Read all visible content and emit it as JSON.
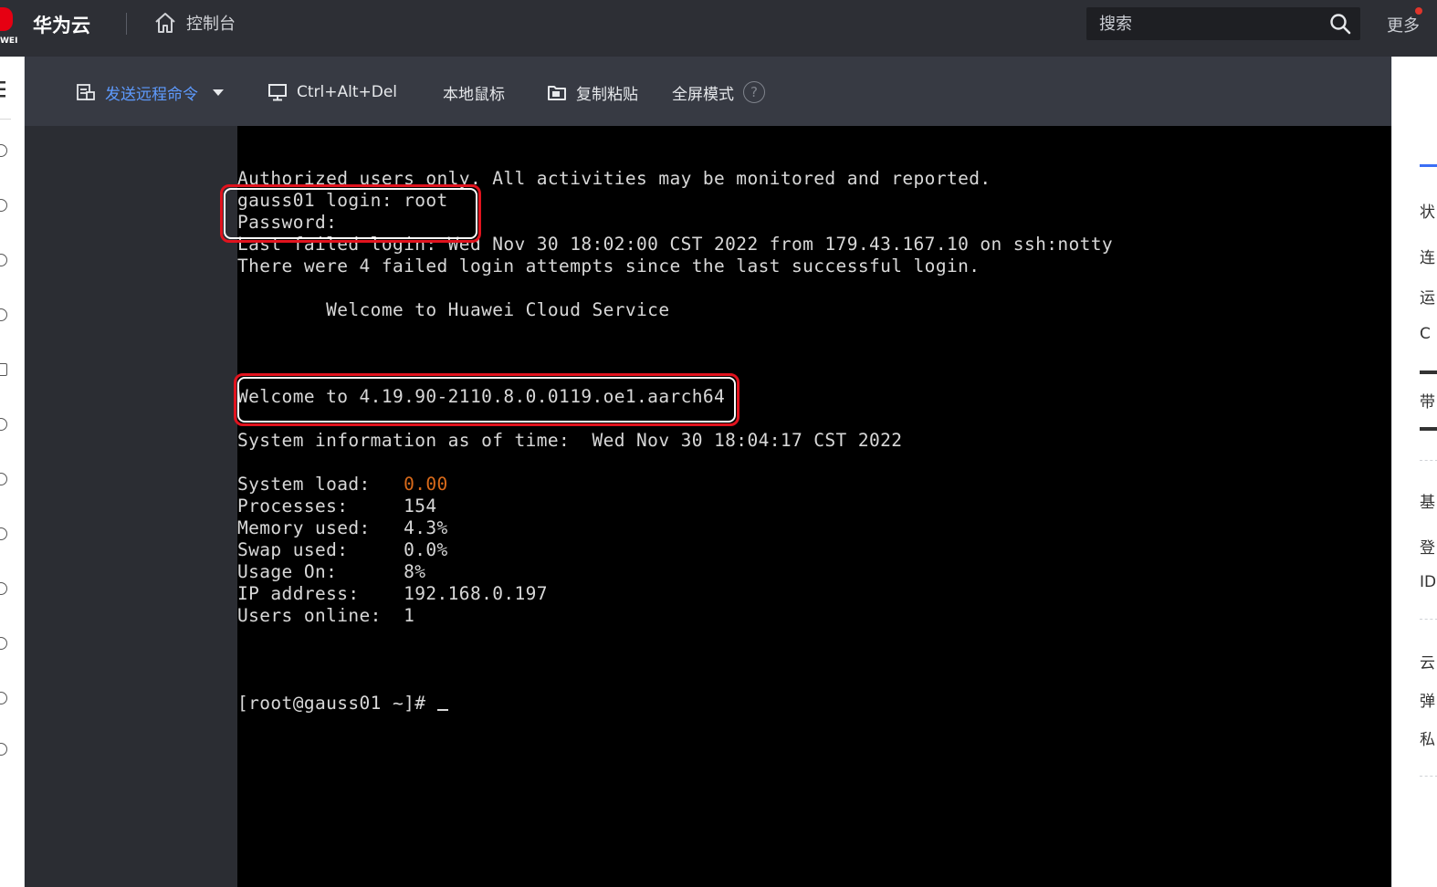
{
  "header": {
    "logo_text": "WEI",
    "brand": "华为云",
    "console_label": "控制台",
    "search_placeholder": "搜索",
    "more_label": "更多"
  },
  "toolbar": {
    "send_command_label": "发送远程命令",
    "ctrl_alt_del_label": "Ctrl+Alt+Del",
    "local_mouse_label": "本地鼠标",
    "copy_paste_label": "复制粘贴",
    "fullscreen_label": "全屏模式",
    "help_glyph": "?"
  },
  "terminal": {
    "lines": [
      "Authorized users only. All activities may be monitored and reported.",
      "gauss01 login: root",
      "Password:",
      "Last failed login: Wed Nov 30 18:02:00 CST 2022 from 179.43.167.10 on ssh:notty",
      "There were 4 failed login attempts since the last successful login.",
      "        Welcome to Huawei Cloud Service",
      "Welcome to 4.19.90-2110.8.0.0119.oe1.aarch64",
      "System information as of time:  Wed Nov 30 18:04:17 CST 2022"
    ],
    "sysinfo": [
      {
        "label": "System load:   ",
        "value": "0.00",
        "highlight": true
      },
      {
        "label": "Processes:     ",
        "value": "154",
        "highlight": false
      },
      {
        "label": "Memory used:   ",
        "value": "4.3%",
        "highlight": false
      },
      {
        "label": "Swap used:     ",
        "value": "0.0%",
        "highlight": false
      },
      {
        "label": "Usage On:      ",
        "value": "8%",
        "highlight": false
      },
      {
        "label": "IP address:    ",
        "value": "192.168.0.197",
        "highlight": false
      },
      {
        "label": "Users online:  ",
        "value": "1",
        "highlight": false
      }
    ],
    "prompt": "[root@gauss01 ~]# "
  },
  "right_panel": {
    "chars": [
      "状",
      "连",
      "运",
      "C",
      "带",
      "基",
      "登",
      "ID",
      "云",
      "弹",
      "私"
    ]
  },
  "colors": {
    "accent_blue": "#5e9bff",
    "annotation_red": "#e1131e",
    "load_orange": "#d96a1a"
  }
}
